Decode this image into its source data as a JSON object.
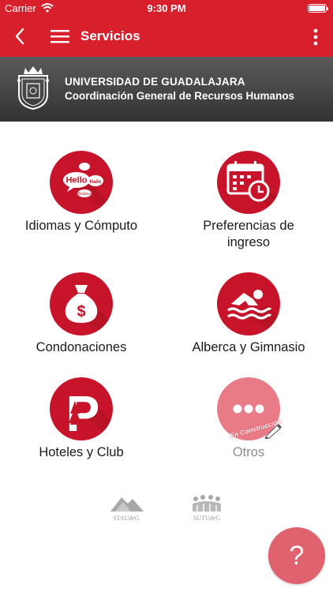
{
  "status_bar": {
    "carrier": "Carrier",
    "time": "9:30 PM"
  },
  "nav": {
    "title": "Servicios"
  },
  "banner": {
    "line1": "UNIVERSIDAD DE GUADALAJARA",
    "line2": "Coordinación General de Recursos Humanos"
  },
  "services": [
    {
      "label": "Idiomas y Cómputo",
      "icon": "speech-bubbles-icon",
      "bubbles": [
        "Hello",
        "Hallo",
        "Bonjour"
      ]
    },
    {
      "label": "Preferencias de ingreso",
      "icon": "calendar-clock-icon"
    },
    {
      "label": "Condonaciones",
      "icon": "money-bag-icon",
      "symbol": "$"
    },
    {
      "label": "Alberca y Gimnasio",
      "icon": "swimmer-icon"
    },
    {
      "label": "Hoteles y Club",
      "icon": "parking-trees-icon",
      "letter": "P"
    },
    {
      "label": "Otros",
      "icon": "more-dots-icon",
      "disabled": true,
      "tag": "En Construcción"
    }
  ],
  "footer_logos": [
    {
      "name": "STAUdeG"
    },
    {
      "name": "SUTUdeG"
    }
  ],
  "help": {
    "label": "?"
  },
  "colors": {
    "header": "#d81f2c",
    "icon": "#c8142a",
    "disabled": "#e97b86",
    "help": "#e0626e",
    "banner": "#3f3f3f"
  }
}
